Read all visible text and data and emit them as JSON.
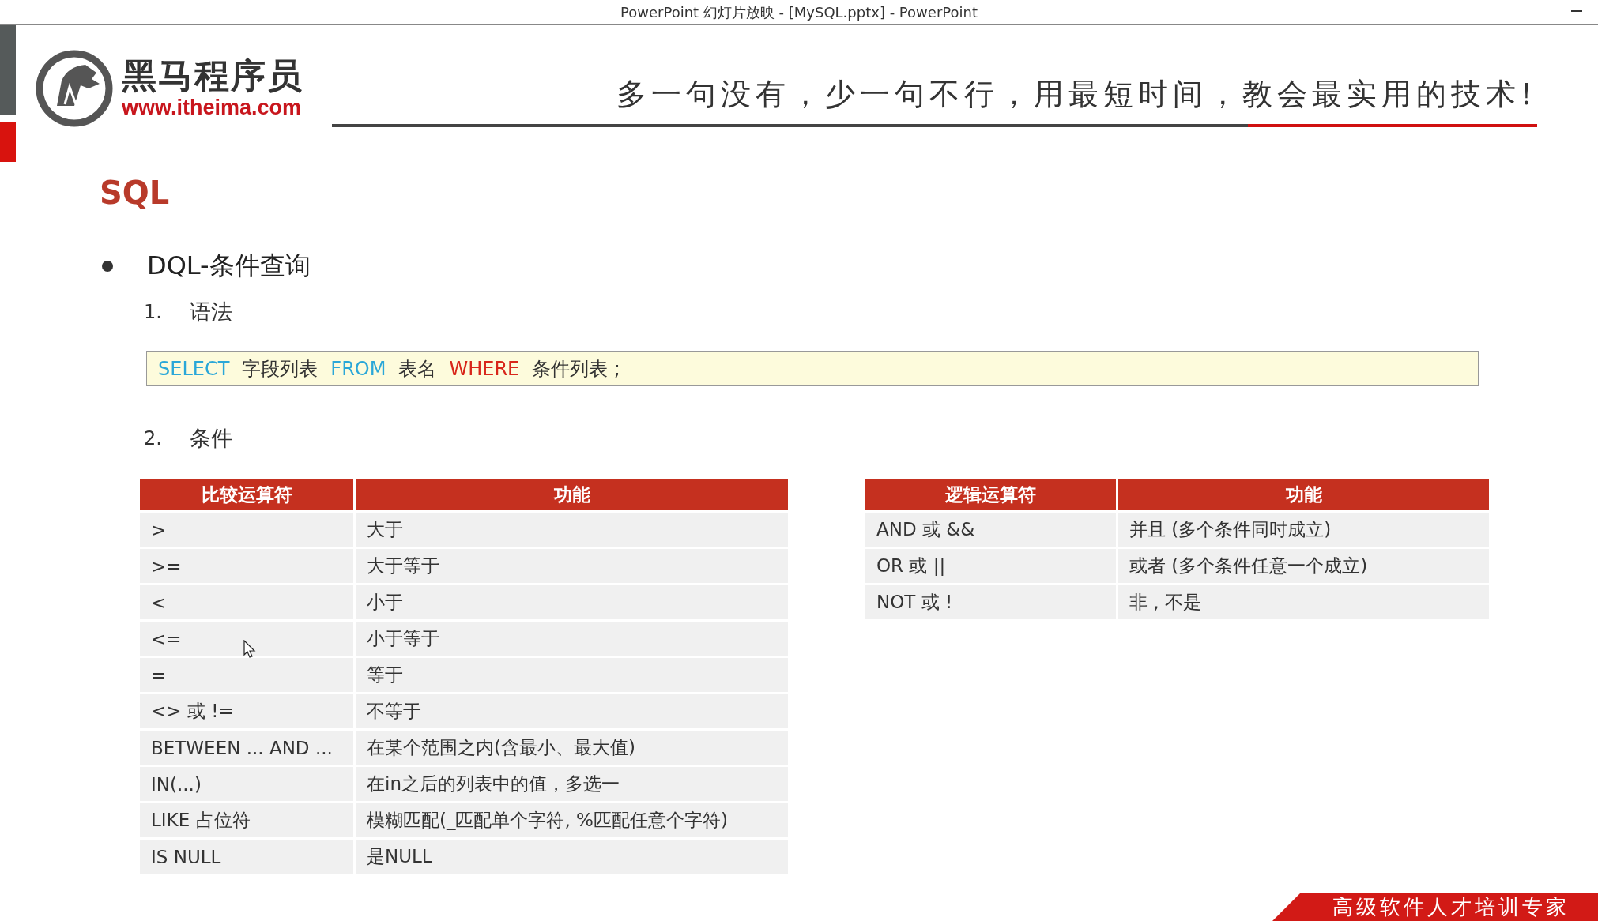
{
  "window": {
    "title": "PowerPoint 幻灯片放映 - [MySQL.pptx] - PowerPoint"
  },
  "logo": {
    "name": "黑马程序员",
    "url": "www.itheima.com"
  },
  "slogan": "多一句没有，少一句不行，用最短时间，教会最实用的技术!",
  "slide": {
    "title": "SQL",
    "bullet": "DQL-条件查询",
    "steps": [
      {
        "number": "1.",
        "label": "语法"
      },
      {
        "number": "2.",
        "label": "条件"
      }
    ],
    "syntax": [
      {
        "text": "SELECT",
        "kind": "keyword"
      },
      {
        "text": "字段列表",
        "kind": "plain"
      },
      {
        "text": "FROM",
        "kind": "keyword"
      },
      {
        "text": "表名",
        "kind": "plain"
      },
      {
        "text": "WHERE",
        "kind": "filter"
      },
      {
        "text": "条件列表 ;",
        "kind": "plain"
      }
    ],
    "tables": [
      {
        "columns": [
          "比较运算符",
          "功能"
        ],
        "rows": [
          [
            ">",
            "大于"
          ],
          [
            ">=",
            "大于等于"
          ],
          [
            "<",
            "小于"
          ],
          [
            "<=",
            "小于等于"
          ],
          [
            "=",
            "等于"
          ],
          [
            "<> 或 !=",
            "不等于"
          ],
          [
            "BETWEEN ... AND ...",
            "在某个范围之内(含最小、最大值)"
          ],
          [
            "IN(...)",
            "在in之后的列表中的值，多选一"
          ],
          [
            "LIKE  占位符",
            "模糊匹配(_匹配单个字符, %匹配任意个字符)"
          ],
          [
            "IS NULL",
            "是NULL"
          ]
        ]
      },
      {
        "columns": [
          "逻辑运算符",
          "功能"
        ],
        "rows": [
          [
            "AND  或  &&",
            "并且 (多个条件同时成立)"
          ],
          [
            "OR  或  ||",
            "或者 (多个条件任意一个成立)"
          ],
          [
            "NOT  或  !",
            "非 , 不是"
          ]
        ]
      }
    ]
  },
  "banner": "高级软件人才培训专家"
}
